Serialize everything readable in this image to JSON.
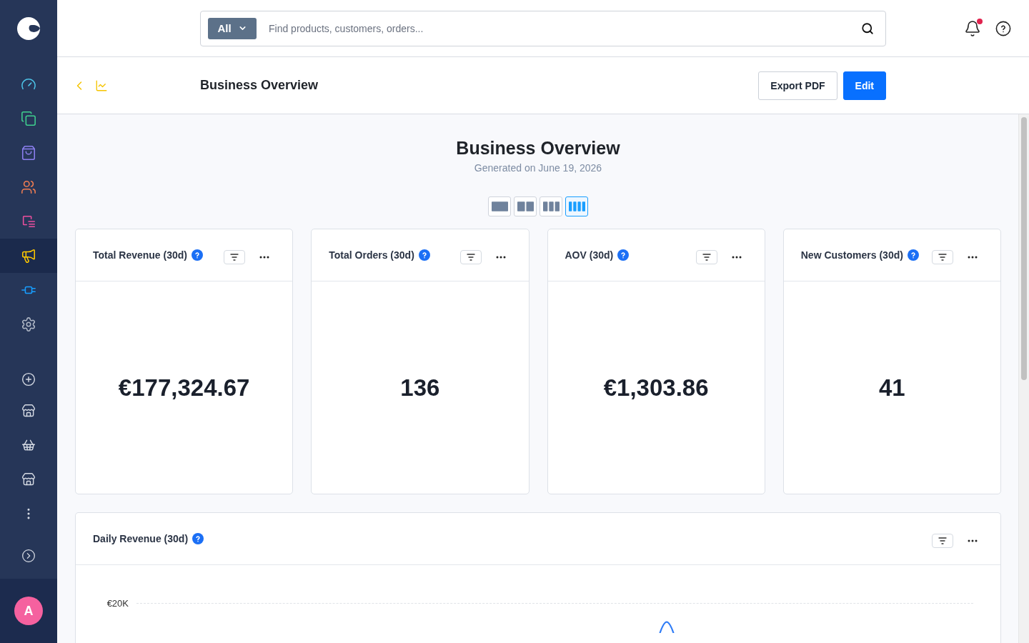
{
  "sidebar": {
    "main_items": [
      {
        "color": "#4cc2e6",
        "selected": false
      },
      {
        "color": "#3fcf8e",
        "selected": false
      },
      {
        "color": "#8c7ff0",
        "selected": false
      },
      {
        "color": "#f07d52",
        "selected": false
      },
      {
        "color": "#ec4f9e",
        "selected": false
      },
      {
        "color": "#ffc800",
        "selected": true
      },
      {
        "color": "#189eff",
        "selected": false
      },
      {
        "color": "#aeb6c4",
        "selected": false
      }
    ],
    "avatar_initial": "A"
  },
  "topbar": {
    "search": {
      "scope": "All",
      "placeholder": "Find products, customers, orders..."
    },
    "notifications": {
      "unread": true
    }
  },
  "header": {
    "title": "Business Overview",
    "buttons": [
      {
        "label": "Export PDF",
        "kind": "secondary"
      },
      {
        "label": "Edit",
        "kind": "primary"
      }
    ]
  },
  "report": {
    "title": "Business Overview",
    "subtitle": "Generated on June 19, 2026",
    "layout_options": [
      {
        "selected": false
      },
      {
        "selected": false
      },
      {
        "selected": false
      },
      {
        "selected": true
      }
    ],
    "kpi_cards": [
      {
        "title": "Total Revenue (30d)",
        "value": "€177,324.67"
      },
      {
        "title": "Total Orders (30d)",
        "value": "136"
      },
      {
        "title": "AOV (30d)",
        "value": "€1,303.86"
      },
      {
        "title": "New Customers (30d)",
        "value": "41"
      }
    ],
    "chart_card": {
      "title": "Daily Revenue (30d)",
      "y_axis_labels": [
        "€20K"
      ]
    }
  }
}
